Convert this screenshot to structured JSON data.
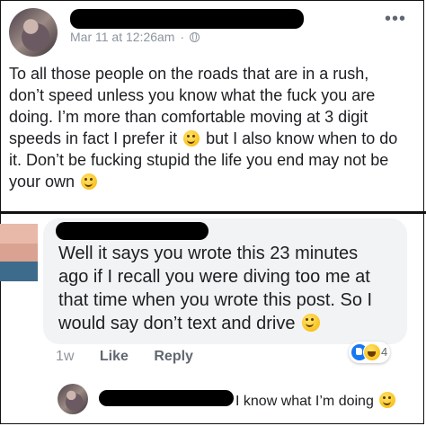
{
  "post": {
    "timestamp": "Mar 11 at 12:26am",
    "separator": "·",
    "audience_icon": "globe-icon",
    "menu_icon": "more-options-icon",
    "lines": [
      "To all those people on the roads that are in a rush,",
      "don’t speed unless you know what the fuck you are",
      "doing. I’m more than comfortable moving at 3 digit",
      "speeds in fact I prefer it",
      "but I also know when to do",
      "it.  Don’t be fucking stupid the life you end may not be",
      "your own"
    ]
  },
  "comment": {
    "lines": [
      "Well it says you wrote this 23 minutes",
      "ago if I recall you were diving too me at",
      "that time when you wrote this post. So I",
      "would say don’t text and drive"
    ],
    "time": "1w",
    "like_label": "Like",
    "reply_label": "Reply",
    "reaction_icons": [
      "like-reaction-icon",
      "haha-reaction-icon"
    ],
    "reaction_count": "4"
  },
  "reply": {
    "text": "I know what I’m doing"
  },
  "colors": {
    "secondary_text": "#8d949e",
    "bubble_bg": "#f2f3f5",
    "like_blue": "#1877f2"
  }
}
